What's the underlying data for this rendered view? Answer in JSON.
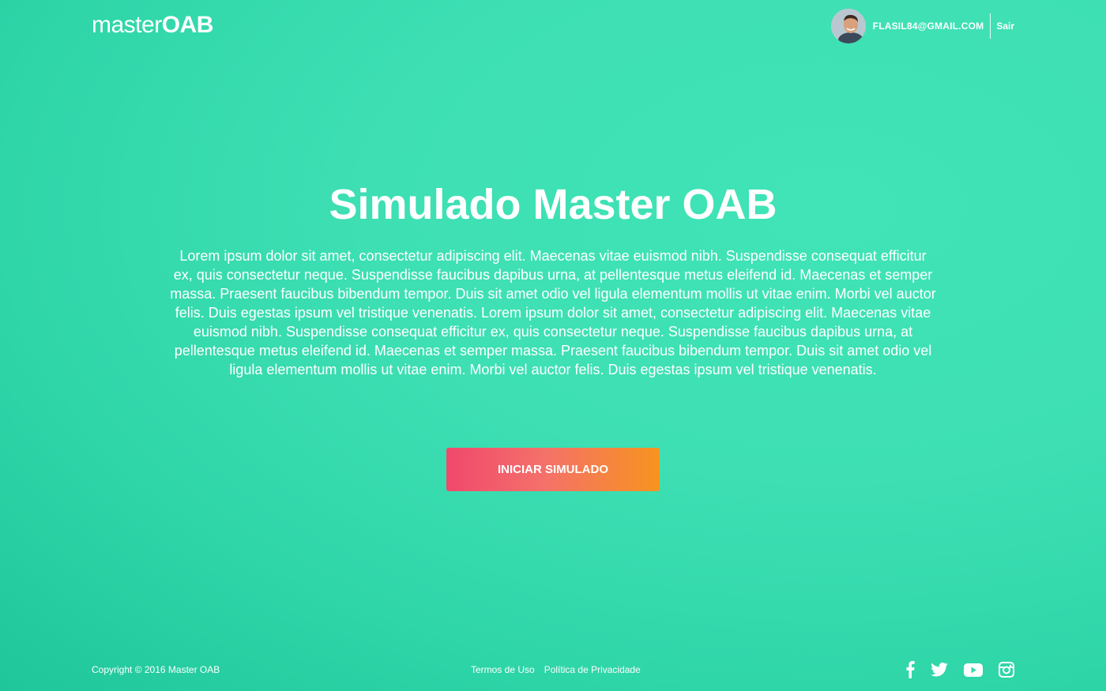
{
  "header": {
    "logo": {
      "part1": "master",
      "part2": "OAB"
    },
    "user": {
      "email": "FLASIL84@GMAIL.COM",
      "logout_label": "Sair",
      "avatar_icon": "user-avatar-photo"
    }
  },
  "hero": {
    "title": "Simulado Master OAB",
    "description": "Lorem ipsum dolor sit amet, consectetur adipiscing elit. Maecenas vitae euismod nibh. Suspendisse consequat efficitur ex, quis consectetur neque. Suspendisse faucibus dapibus urna, at pellentesque metus eleifend id. Maecenas et semper massa. Praesent faucibus bibendum tempor. Duis sit amet odio vel ligula elementum mollis ut vitae enim. Morbi vel auctor felis. Duis egestas ipsum vel tristique venenatis. Lorem ipsum dolor sit amet, consectetur adipiscing elit. Maecenas vitae euismod nibh. Suspendisse consequat efficitur ex, quis consectetur neque. Suspendisse faucibus dapibus urna, at pellentesque metus eleifend id. Maecenas et semper massa. Praesent faucibus bibendum tempor. Duis sit amet odio vel ligula elementum mollis ut vitae enim. Morbi vel auctor felis. Duis egestas ipsum vel tristique venenatis.",
    "cta_label": "INICIAR SIMULADO"
  },
  "footer": {
    "copyright": "Copyright © 2016 Master OAB",
    "links": [
      "Termos de Uso",
      "Política de Privacidade"
    ],
    "social": [
      "facebook-icon",
      "twitter-icon",
      "youtube-icon",
      "instagram-icon"
    ]
  },
  "colors": {
    "background": "#3ddfb3",
    "background_dark": "#1fc69a",
    "cta_start": "#f0486c",
    "cta_end": "#f7941f",
    "text": "#ffffff"
  }
}
